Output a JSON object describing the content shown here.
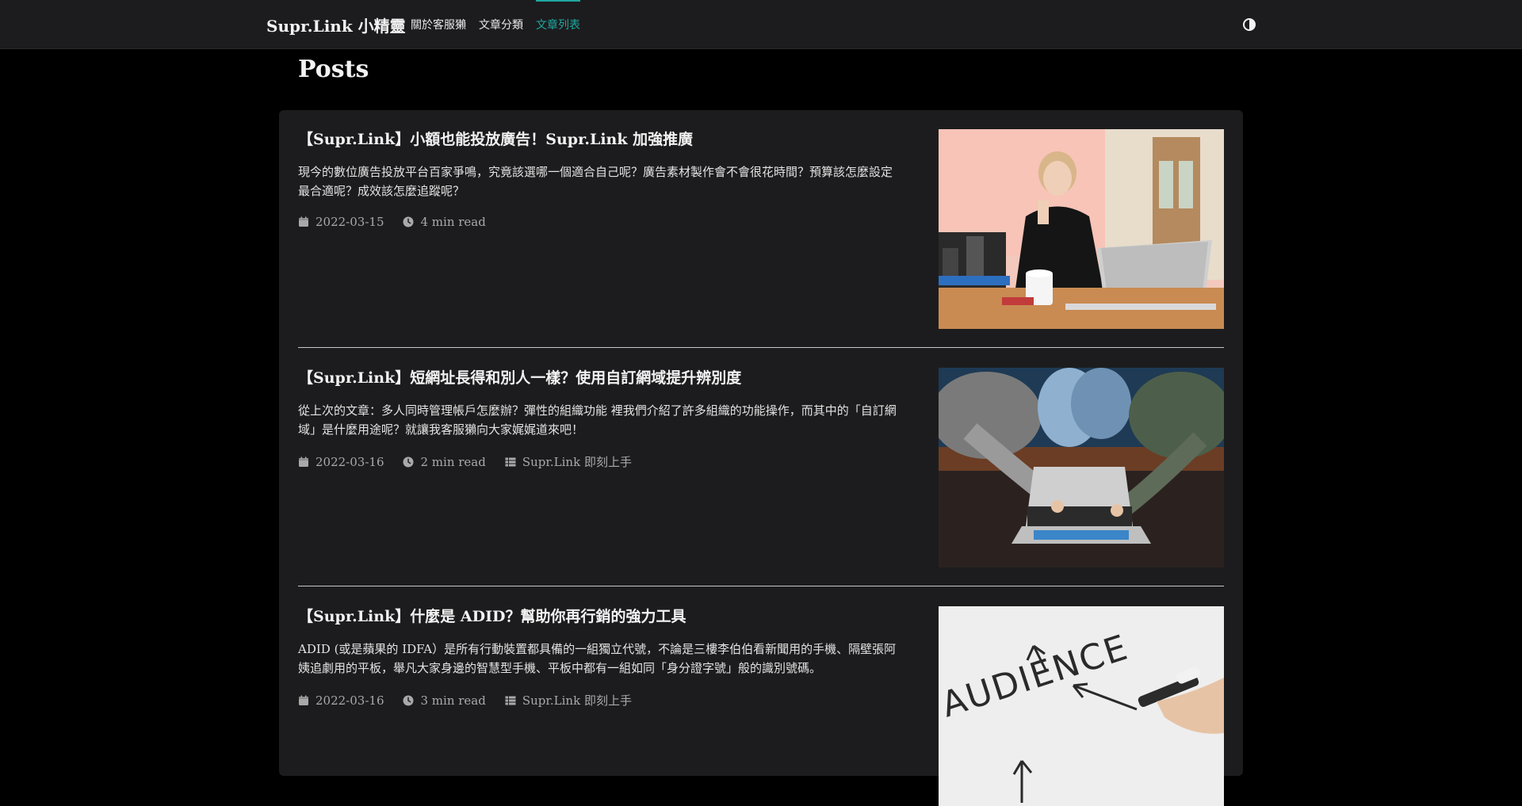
{
  "nav": {
    "brand": "Supr.Link 小精靈",
    "links": [
      "關於客服獺",
      "文章分類",
      "文章列表"
    ],
    "active_index": 2,
    "theme_toggle_icon": "contrast-icon",
    "accent_color": "#1fa8a0"
  },
  "page": {
    "title": "Posts"
  },
  "posts": [
    {
      "title": "【Supr.Link】小額也能投放廣告！Supr.Link 加強推廣",
      "summary": "現今的數位廣告投放平台百家爭鳴，究竟該選哪一個適合自己呢？廣告素材製作會不會很花時間？預算該怎麼設定最合適呢？成效該怎麼追蹤呢？",
      "date": "2022-03-15",
      "read_time": "4 min read",
      "category": ""
    },
    {
      "title": "【Supr.Link】短網址長得和別人一樣？使用自訂網域提升辨別度",
      "summary": "從上次的文章：多人同時管理帳戶怎麼辦？彈性的組織功能 裡我們介紹了許多組織的功能操作，而其中的「自訂網域」是什麼用途呢？就讓我客服獺向大家娓娓道來吧！",
      "date": "2022-03-16",
      "read_time": "2 min read",
      "category": "Supr.Link 即刻上手"
    },
    {
      "title": "【Supr.Link】什麼是 ADID？幫助你再行銷的強力工具",
      "summary": "ADID (或是蘋果的 IDFA）是所有行動裝置都具備的一組獨立代號，不論是三樓李伯伯看新聞用的手機、隔壁張阿姨追劇用的平板，舉凡大家身邊的智慧型手機、平板中都有一組如同「身分證字號」般的識別號碼。",
      "date": "2022-03-16",
      "read_time": "3 min read",
      "category": "Supr.Link 即刻上手",
      "thumb_text": "AUDIENCE"
    }
  ]
}
